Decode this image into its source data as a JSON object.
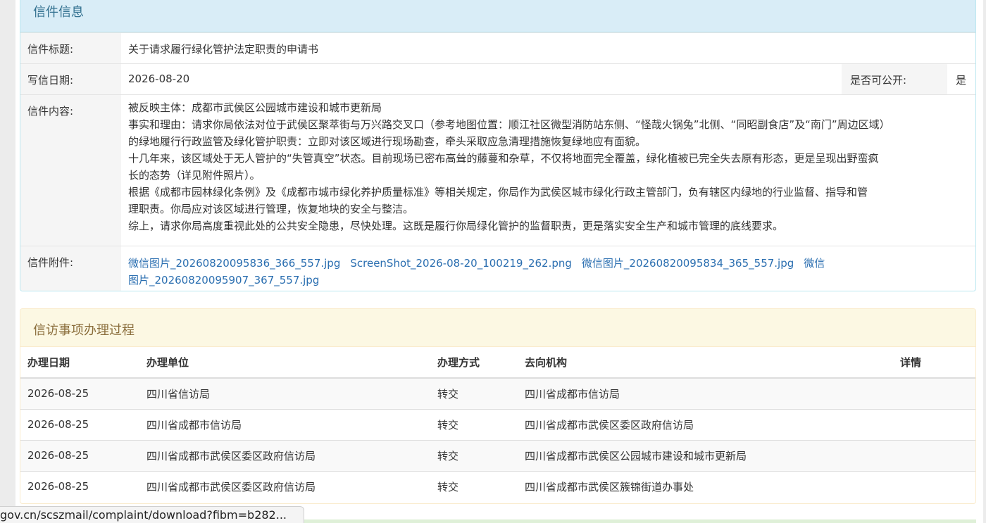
{
  "letter_panel": {
    "title": "信件信息",
    "subject_label": "信件标题:",
    "subject_value": "关于请求履行绿化管护法定职责的申请书",
    "date_label": "写信日期:",
    "date_value": "2026-08-20",
    "public_label": "是否可公开:",
    "public_value": "是",
    "content_label": "信件内容:",
    "content_lines": [
      "被反映主体：成都市武侯区公园城市建设和城市更新局",
      "事实和理由：请求你局依法对位于武侯区聚萃街与万兴路交叉口（参考地图位置：顺江社区微型消防站东侧、“怪哉火锅兔”北侧、“同昭副食店”及“南门”周边区域）",
      "的绿地履行行政监管及绿化管护职责：立即对该区域进行现场勘查，牵头采取应急清理措施恢复绿地应有面貌。",
      "十几年来，该区域处于无人管护的“失管真空”状态。目前现场已密布高耸的藤蔓和杂草，不仅将地面完全覆盖，绿化植被已完全失去原有形态，更是呈现出野蛮疯",
      "长的态势（详见附件照片）。",
      "根据《成都市园林绿化条例》及《成都市城市绿化养护质量标准》等相关规定，你局作为武侯区城市绿化行政主管部门，负有辖区内绿地的行业监督、指导和管",
      "理职责。你局应对该区域进行管理，恢复地块的安全与整洁。",
      "综上，请求你局高度重视此处的公共安全隐患，尽快处理。这既是履行你局绿化管护的监督职责，更是落实安全生产和城市管理的底线要求。"
    ],
    "attachment_label": "信件附件:",
    "attachments": [
      "微信图片_20260820095836_366_557.jpg",
      "ScreenShot_2026-08-20_100219_262.png",
      "微信图片_20260820095834_365_557.jpg",
      "微信图片_20260820095907_367_557.jpg"
    ]
  },
  "process_panel": {
    "title": "信访事项办理过程",
    "headers": [
      "办理日期",
      "办理单位",
      "办理方式",
      "去向机构",
      "详情"
    ],
    "rows": [
      [
        "2026-08-25",
        "四川省信访局",
        "转交",
        "四川省成都市信访局",
        ""
      ],
      [
        "2026-08-25",
        "四川省成都市信访局",
        "转交",
        "四川省成都市武侯区委区政府信访局",
        ""
      ],
      [
        "2026-08-25",
        "四川省成都市武侯区委区政府信访局",
        "转交",
        "四川省成都市武侯区公园城市建设和城市更新局",
        ""
      ],
      [
        "2026-08-25",
        "四川省成都市武侯区委区政府信访局",
        "转交",
        "四川省成都市武侯区簇锦街道办事处",
        ""
      ]
    ]
  },
  "status_bar": {
    "url": "gov.cn/scszmail/complaint/download?fibm=b282..."
  }
}
